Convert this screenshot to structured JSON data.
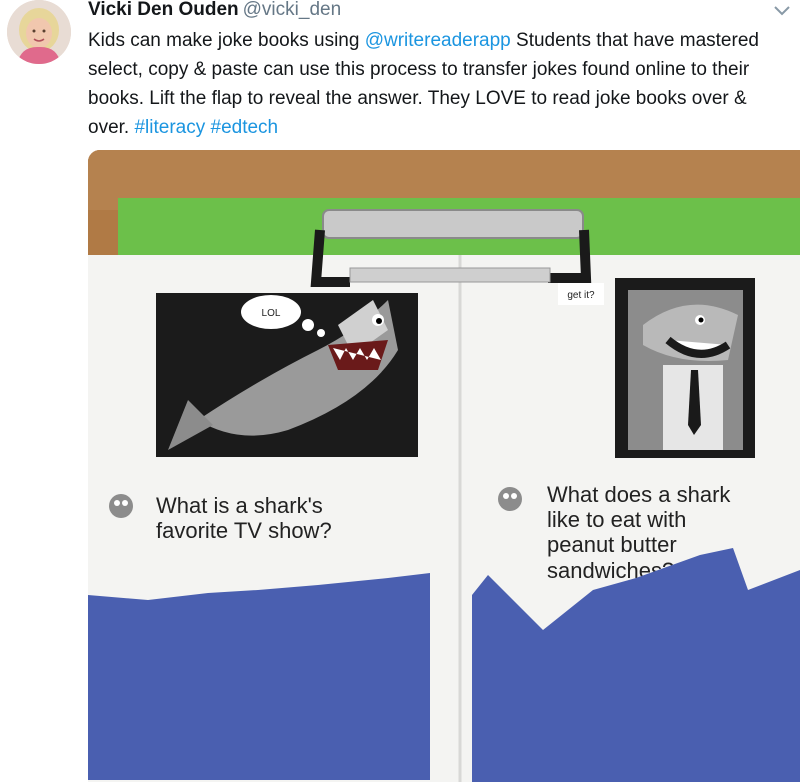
{
  "tweet": {
    "display_name": "Vicki Den Ouden",
    "handle": "@vicki_den",
    "text": [
      {
        "t": "Kids can make joke books using ",
        "link": false
      },
      {
        "t": "@writereaderapp",
        "link": true
      },
      {
        "t": " Students that have mastered select, copy & paste can use this process to transfer jokes found online to their books. Lift the flap to reveal the answer. They LOVE to read joke books over & over. ",
        "link": false
      },
      {
        "t": "#literacy",
        "link": true
      },
      {
        "t": " ",
        "link": false
      },
      {
        "t": "#edtech",
        "link": true
      }
    ],
    "icons": {
      "more": "chevron-down-icon",
      "avatar": "avatar"
    },
    "colors": {
      "link": "#1b95e0",
      "handle": "#657786",
      "text": "#14171a"
    }
  },
  "photo": {
    "left_page": {
      "bubble": "LOL",
      "question_line1": "What is a shark's",
      "question_line2": "favorite TV show?"
    },
    "right_page": {
      "bubble": "get it?",
      "question_line1": "What does a shark",
      "question_line2": "like to eat with",
      "question_line3": "peanut butter",
      "question_line4": "sandwiches?"
    },
    "colors": {
      "table": "#b07a45",
      "clipboard": "#6cc04a",
      "flap": "#4a5fb0",
      "paper": "#f4f4f2"
    }
  }
}
